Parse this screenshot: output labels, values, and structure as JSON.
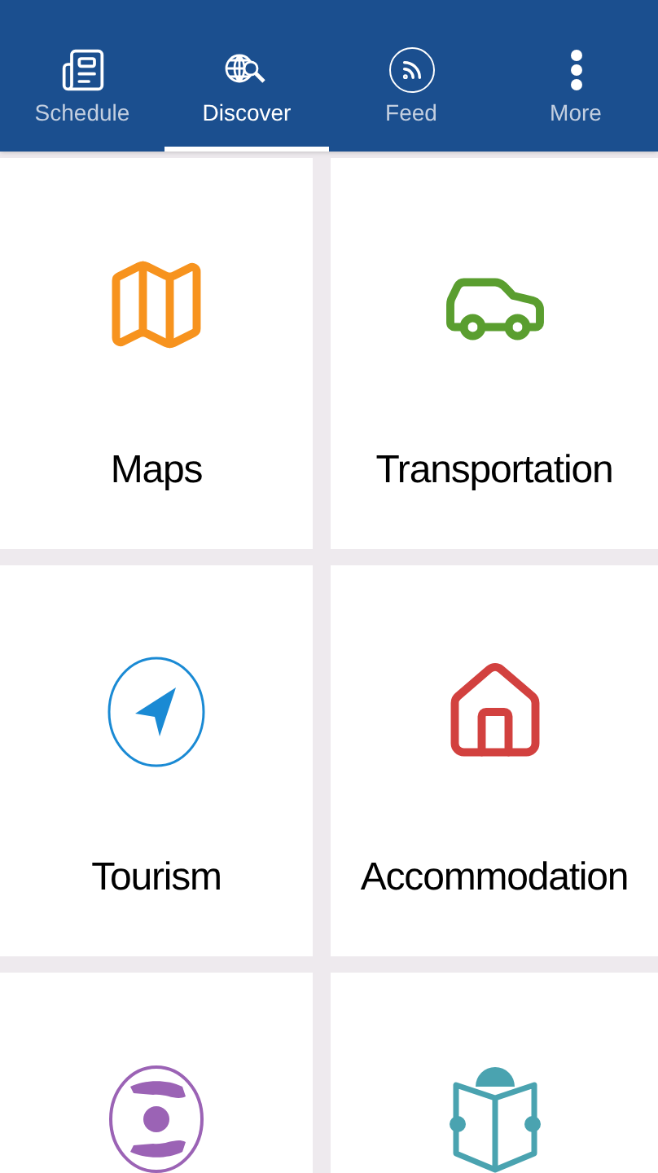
{
  "tabs": [
    {
      "label": "Schedule",
      "kind": "newspaper",
      "selected": false
    },
    {
      "label": "Discover",
      "kind": "globe",
      "selected": true
    },
    {
      "label": "Feed",
      "kind": "rss",
      "selected": false
    },
    {
      "label": "More",
      "kind": "dots",
      "selected": false
    }
  ],
  "tiles": [
    {
      "label": "Maps",
      "kind": "map",
      "color": "#f7931e"
    },
    {
      "label": "Transportation",
      "kind": "car",
      "color": "#5a9e2f"
    },
    {
      "label": "Tourism",
      "kind": "navigation",
      "color": "#1a8ad4"
    },
    {
      "label": "Accommodation",
      "kind": "house",
      "color": "#d2413f"
    },
    {
      "kind": "hands",
      "color": "#9b63b5"
    },
    {
      "kind": "reader",
      "color": "#4aa3b0"
    }
  ]
}
